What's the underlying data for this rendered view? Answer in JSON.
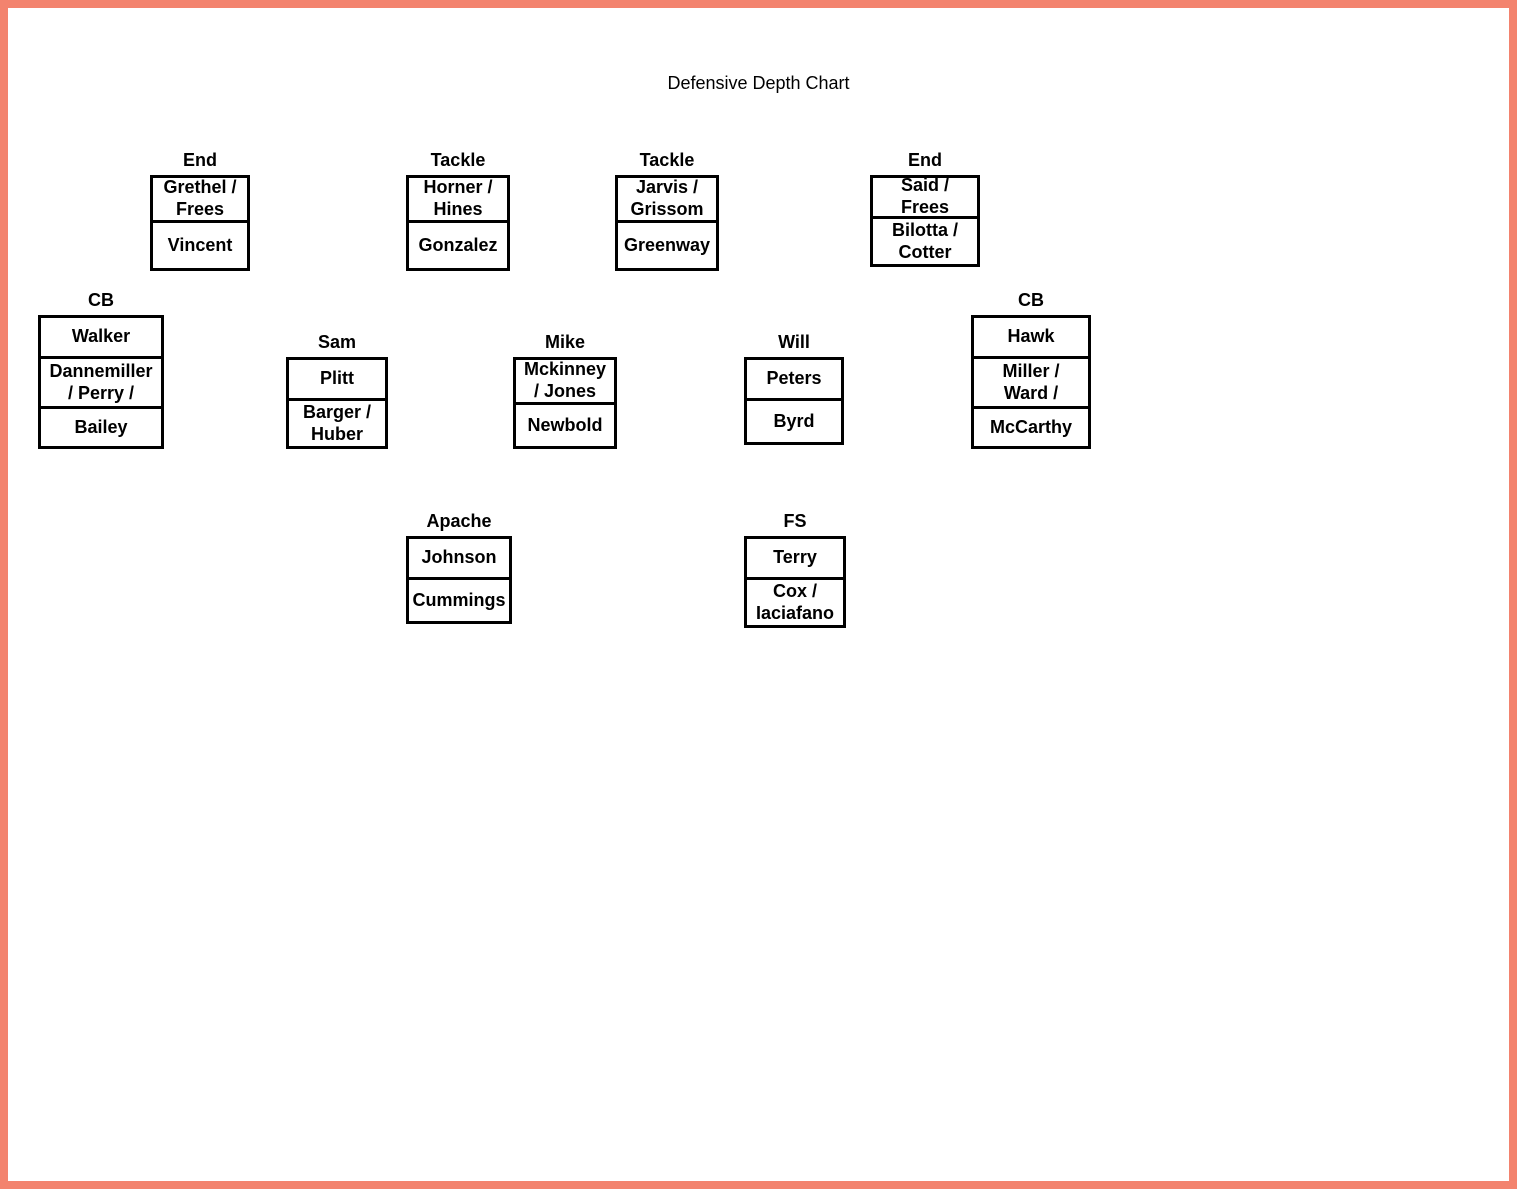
{
  "title": "Defensive Depth Chart",
  "positions": {
    "end_left": {
      "label": "End",
      "row1": "Grethel / Frees",
      "row2": "Vincent"
    },
    "tackle_left": {
      "label": "Tackle",
      "row1": "Horner / Hines",
      "row2": "Gonzalez"
    },
    "tackle_right": {
      "label": "Tackle",
      "row1": "Jarvis / Grissom",
      "row2": "Greenway"
    },
    "end_right": {
      "label": "End",
      "row1": "Said / Frees",
      "row2": "Bilotta / Cotter"
    },
    "cb_left": {
      "label": "CB",
      "row1": "Walker",
      "row2": "Dannemiller / Perry /",
      "row3": "Bailey"
    },
    "sam": {
      "label": "Sam",
      "row1": "Plitt",
      "row2": "Barger / Huber"
    },
    "mike": {
      "label": "Mike",
      "row1": "Mckinney / Jones",
      "row2": "Newbold"
    },
    "will": {
      "label": "Will",
      "row1": "Peters",
      "row2": "Byrd"
    },
    "cb_right": {
      "label": "CB",
      "row1": "Hawk",
      "row2": "Miller / Ward /",
      "row3": "McCarthy"
    },
    "apache": {
      "label": "Apache",
      "row1": "Johnson",
      "row2": "Cummings"
    },
    "fs": {
      "label": "FS",
      "row1": "Terry",
      "row2": "Cox / Iaciafano"
    }
  }
}
